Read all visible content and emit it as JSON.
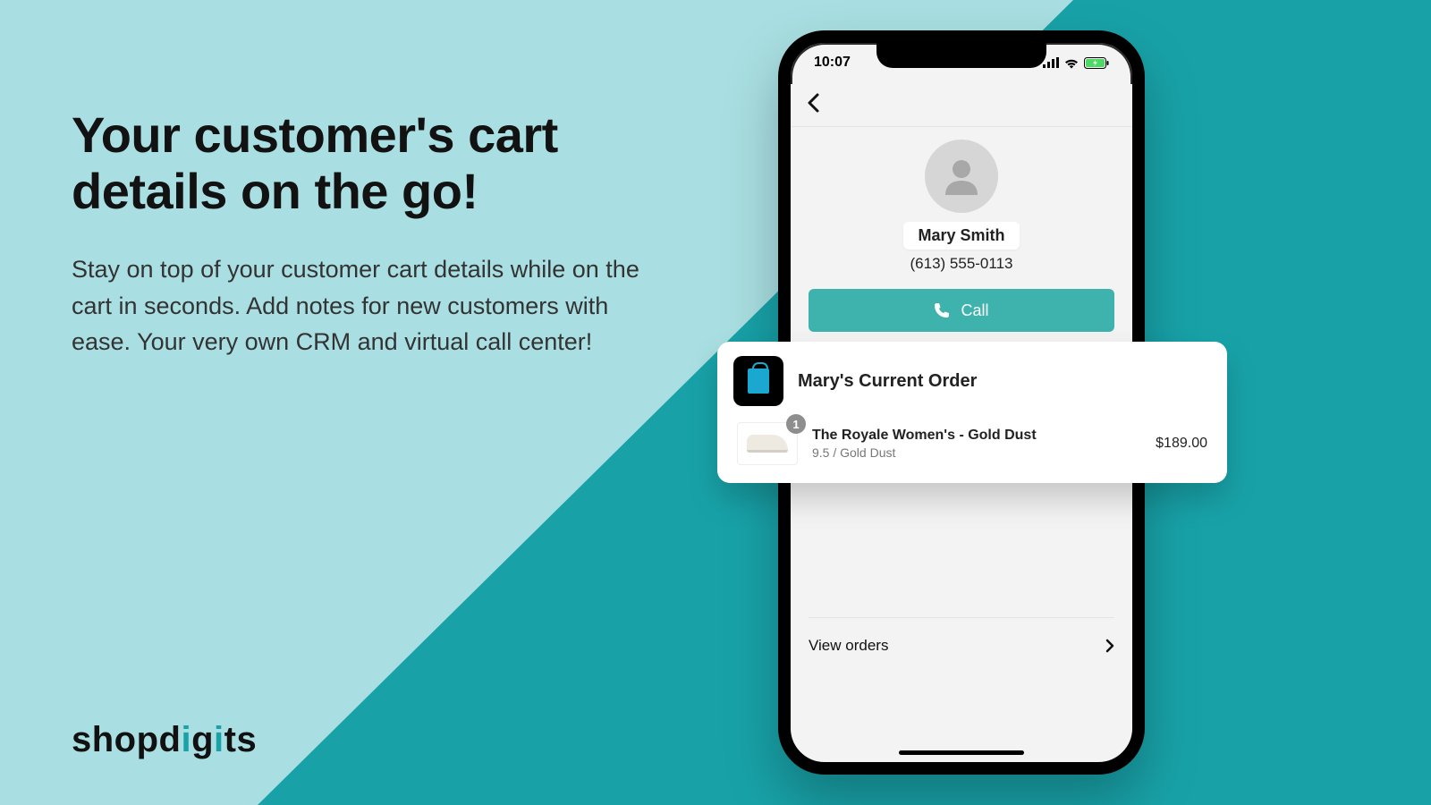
{
  "promo": {
    "headline_line1": "Your customer's cart",
    "headline_line2": "details on the go!",
    "subtext": "Stay on top of your customer cart details while on the cart in seconds. Add notes for new customers with ease. Your very own CRM and virtual call center!"
  },
  "brand": {
    "pre": "shopd",
    "accent": "i",
    "mid": "g",
    "accent2": "i",
    "post": "ts"
  },
  "phone": {
    "status_time": "10:07",
    "customer_name": "Mary Smith",
    "customer_phone": "(613) 555-0113",
    "call_label": "Call",
    "view_orders_label": "View orders"
  },
  "order_card": {
    "title": "Mary's Current Order",
    "item": {
      "qty": "1",
      "name": "The Royale Women's - Gold Dust",
      "variant": "9.5 / Gold Dust",
      "price": "$189.00"
    }
  }
}
